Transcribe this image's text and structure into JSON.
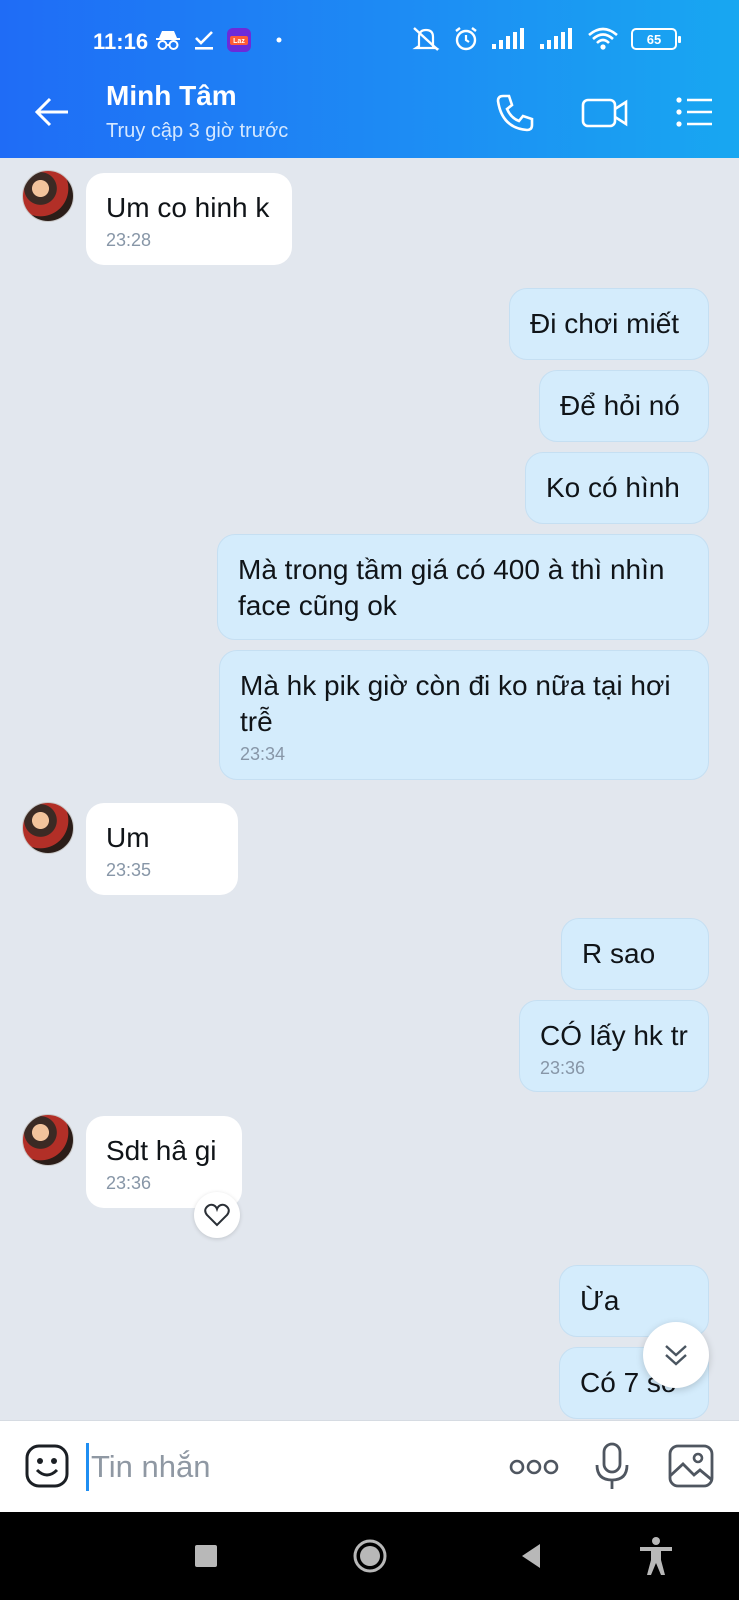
{
  "status_bar": {
    "time": "11:16",
    "battery": "65",
    "icons": [
      "incognito-icon",
      "check-icon",
      "lazada-app-icon",
      "dot-icon",
      "mute-icon",
      "alarm-icon",
      "signal-icon",
      "signal-icon",
      "wifi-icon",
      "battery-icon"
    ]
  },
  "header": {
    "contact_name": "Minh Tâm",
    "contact_status": "Truy cập 3 giờ trước",
    "icons": [
      "back-arrow-icon",
      "phone-icon",
      "video-call-icon",
      "menu-list-icon"
    ]
  },
  "messages": [
    {
      "direction": "in",
      "text": "Um co hinh k",
      "time": "23:28"
    },
    {
      "direction": "out",
      "text": "Đi chơi miết",
      "time": ""
    },
    {
      "direction": "out",
      "text": "Để hỏi nó",
      "time": ""
    },
    {
      "direction": "out",
      "text": "Ko có hình",
      "time": ""
    },
    {
      "direction": "out",
      "text": "Mà trong tầm giá có 400 à thì nhìn face cũng ok",
      "time": ""
    },
    {
      "direction": "out",
      "text": "Mà hk pik giờ còn đi ko nữa tại hơi trễ",
      "time": "23:34"
    },
    {
      "direction": "in",
      "text": "Um",
      "time": "23:35"
    },
    {
      "direction": "out",
      "text": "R sao",
      "time": ""
    },
    {
      "direction": "out",
      "text": "CÓ lấy hk tr",
      "time": "23:36"
    },
    {
      "direction": "in",
      "text": "Sdt hâ gi",
      "time": "23:36"
    },
    {
      "direction": "out",
      "text": "Ừa",
      "time": ""
    },
    {
      "direction": "out",
      "text": "Có 7 số",
      "time": ""
    }
  ],
  "input": {
    "placeholder": "Tin nhắn",
    "value": ""
  },
  "colors": {
    "header_gradient_start": "#1f6cf6",
    "header_gradient_end": "#18a7f1",
    "chat_background": "#e2e7ee",
    "incoming_bubble": "#ffffff",
    "outgoing_bubble": "#d4ecfc",
    "time_text": "#8796a7"
  }
}
